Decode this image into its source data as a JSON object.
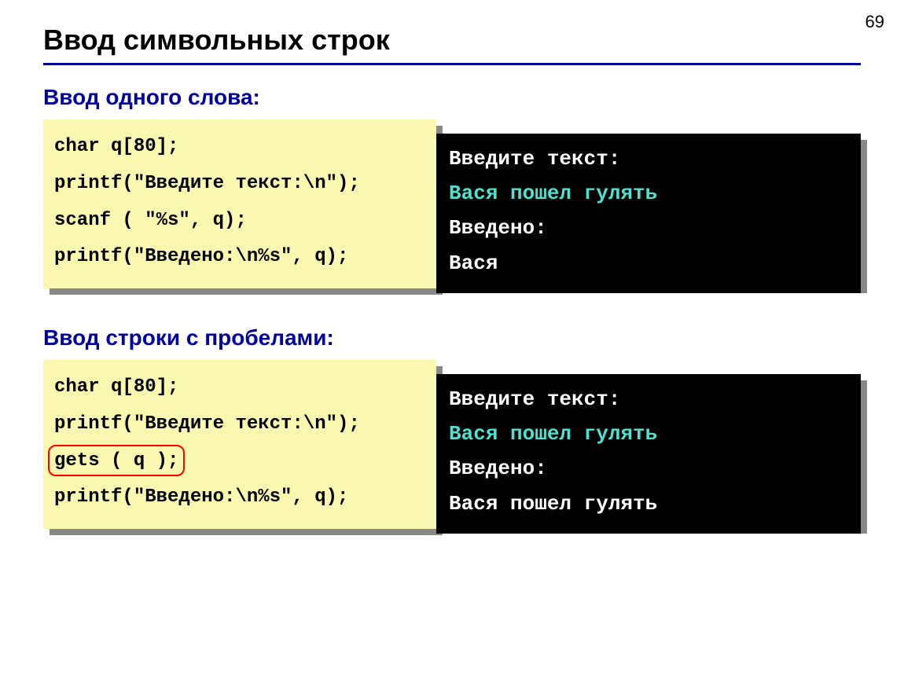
{
  "page_number": "69",
  "title": "Ввод символьных строк",
  "section1": {
    "heading": "Ввод одного слова:",
    "code_line1": "char q[80];",
    "code_line2": "printf(\"Введите текст:\\n\");",
    "code_line3": "scanf ( \"%s\", q);",
    "code_line4": "printf(\"Введено:\\n%s\", q);",
    "term_line1": "Введите текст:",
    "term_line2": "Вася пошел гулять",
    "term_line3": "Введено:",
    "term_line4": "Вася"
  },
  "section2": {
    "heading": "Ввод строки с пробелами:",
    "code_line1": "char q[80];",
    "code_line2": "printf(\"Введите текст:\\n\");",
    "code_line3": "gets ( q );",
    "code_line4": "printf(\"Введено:\\n%s\", q);",
    "term_line1": "Введите текст:",
    "term_line2": "Вася пошел гулять",
    "term_line3": "Введено:",
    "term_line4": "Вася пошел гулять"
  }
}
